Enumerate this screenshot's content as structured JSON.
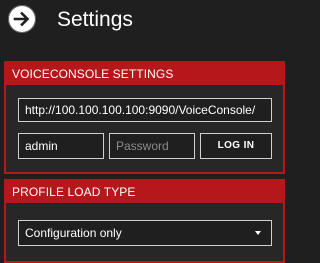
{
  "header": {
    "back_icon": "arrow-right-circle-icon",
    "title": "Settings"
  },
  "voiceconsole": {
    "section_title": "VOICECONSOLE SETTINGS",
    "url_value": "http://100.100.100.100:9090/VoiceConsole/",
    "username_value": "admin",
    "password_placeholder": "Password",
    "login_label": "LOG IN"
  },
  "profile": {
    "section_title": "PROFILE LOAD TYPE",
    "selected": "Configuration only",
    "dropdown_icon": "caret-down-icon"
  },
  "colors": {
    "accent": "#b5171a",
    "background": "#1f1f1f",
    "panel": "#272727"
  }
}
